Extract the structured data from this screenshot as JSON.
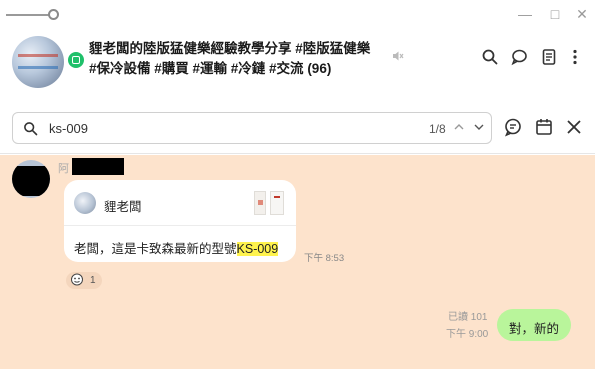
{
  "window": {
    "minimize": "—",
    "maximize": "□",
    "close": "✕"
  },
  "header": {
    "title_line1": "貍老闆的陸版猛健樂經驗教學分享 #陸版猛健樂",
    "title_line2": "#保冷設備 #購買 #運輸 #冷鏈 #交流",
    "member_count": "(96)",
    "icons": [
      "search-icon",
      "chat-bubble-icon",
      "notes-icon",
      "more-icon"
    ]
  },
  "search": {
    "query": "ks-009",
    "result_counter": "1/8"
  },
  "messages": {
    "incoming": {
      "sender_prefix": "阿",
      "reply_to_name": "貍老闆",
      "text_before": "老闆，這是卡致森最新的型號",
      "highlight": "KS-009",
      "time": "下午 8:53",
      "reaction_count": "1"
    },
    "outgoing": {
      "read_receipt": "已讀 101",
      "time": "下午 9:00",
      "text": "對，新的"
    }
  },
  "colors": {
    "chat_background": "#fde3cc",
    "outgoing_bubble": "#b9f59b",
    "highlight": "#fff34d",
    "online_dot": "#1fc06a"
  }
}
